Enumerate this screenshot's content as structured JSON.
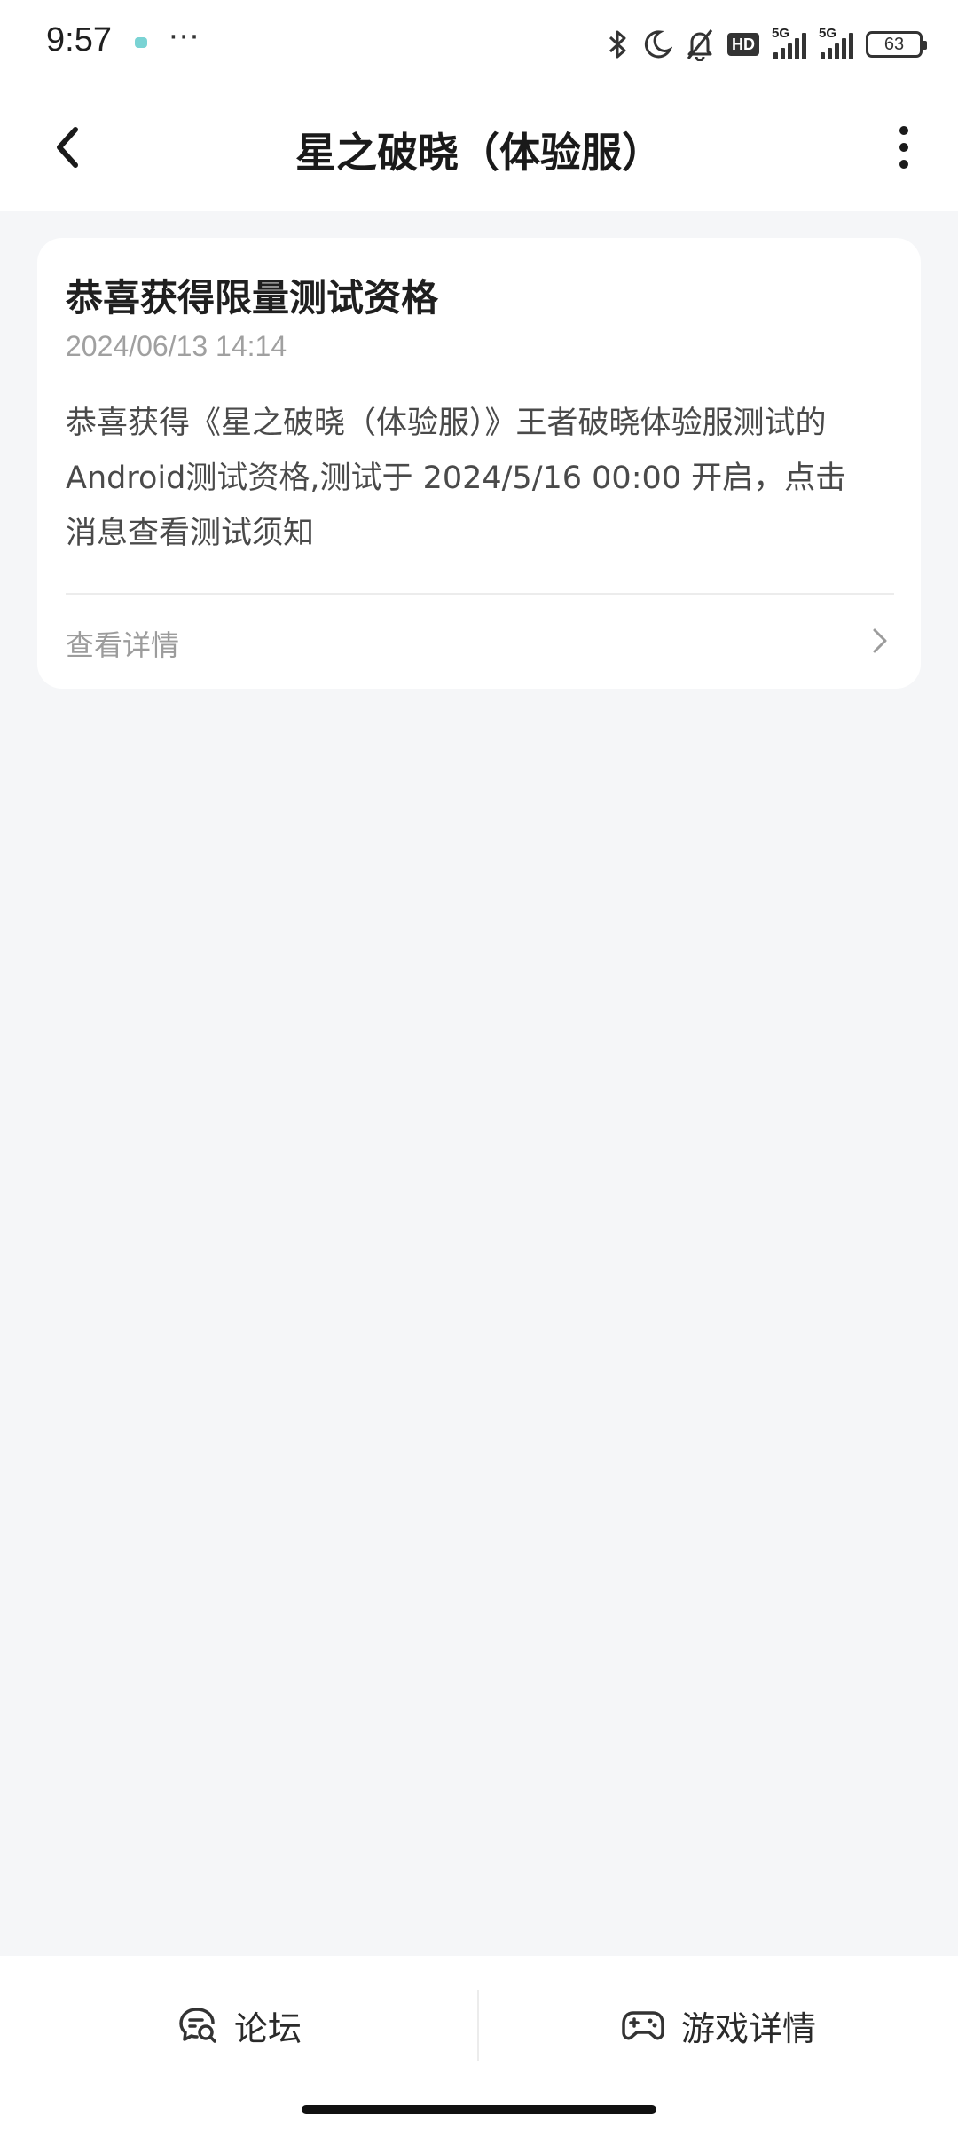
{
  "status_bar": {
    "time": "9:57",
    "more": "···",
    "hd_label": "HD",
    "signal1_label": "5G",
    "signal2_label": "5G",
    "battery": "63",
    "icons": [
      "bluetooth-icon",
      "moon-icon",
      "silent-bell-icon",
      "hd-icon",
      "signal-icon",
      "signal-icon",
      "battery-icon"
    ]
  },
  "header": {
    "title": "星之破晓（体验服）",
    "back_icon": "chevron-left-icon",
    "more_icon": "more-vertical-icon"
  },
  "message": {
    "title": "恭喜获得限量测试资格",
    "date": "2024/06/13 14:14",
    "body_line1": "恭喜获得《星之破晓（体验服）》王者破晓体验服测试的",
    "body_line2": "Android测试资格,测试于 2024/5/16 00:00 开启，点击",
    "body_line3": "消息查看测试须知",
    "detail_label": "查看详情",
    "detail_icon": "chevron-right-icon"
  },
  "bottom_bar": {
    "forum_label": "论坛",
    "forum_icon": "chat-search-icon",
    "game_detail_label": "游戏详情",
    "game_detail_icon": "gamepad-icon"
  }
}
